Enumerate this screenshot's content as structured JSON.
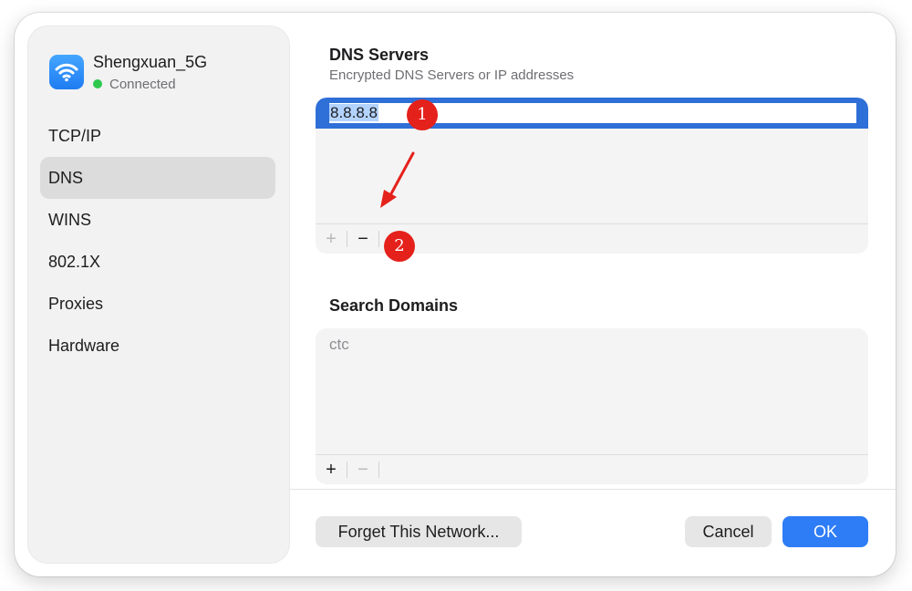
{
  "network": {
    "name": "Shengxuan_5G",
    "status": "Connected",
    "status_color": "#2dc84d",
    "icon": "wifi-icon"
  },
  "sidebar": {
    "items": [
      {
        "label": "TCP/IP",
        "selected": false
      },
      {
        "label": "DNS",
        "selected": true
      },
      {
        "label": "WINS",
        "selected": false
      },
      {
        "label": "802.1X",
        "selected": false
      },
      {
        "label": "Proxies",
        "selected": false
      },
      {
        "label": "Hardware",
        "selected": false
      }
    ]
  },
  "dns": {
    "title": "DNS Servers",
    "subtitle": "Encrypted DNS Servers or IP addresses",
    "entries": [
      "8.8.8.8"
    ],
    "add_label": "+",
    "remove_label": "−"
  },
  "search_domains": {
    "title": "Search Domains",
    "entries": [
      "ctc"
    ],
    "add_label": "+",
    "remove_label": "−"
  },
  "footer": {
    "forget_label": "Forget This Network...",
    "cancel_label": "Cancel",
    "ok_label": "OK"
  },
  "annotations": {
    "badge_1": "1",
    "badge_2": "2",
    "color": "#e5211b"
  },
  "colors": {
    "accent": "#2e7cf6",
    "selection": "#2f6fd8"
  }
}
